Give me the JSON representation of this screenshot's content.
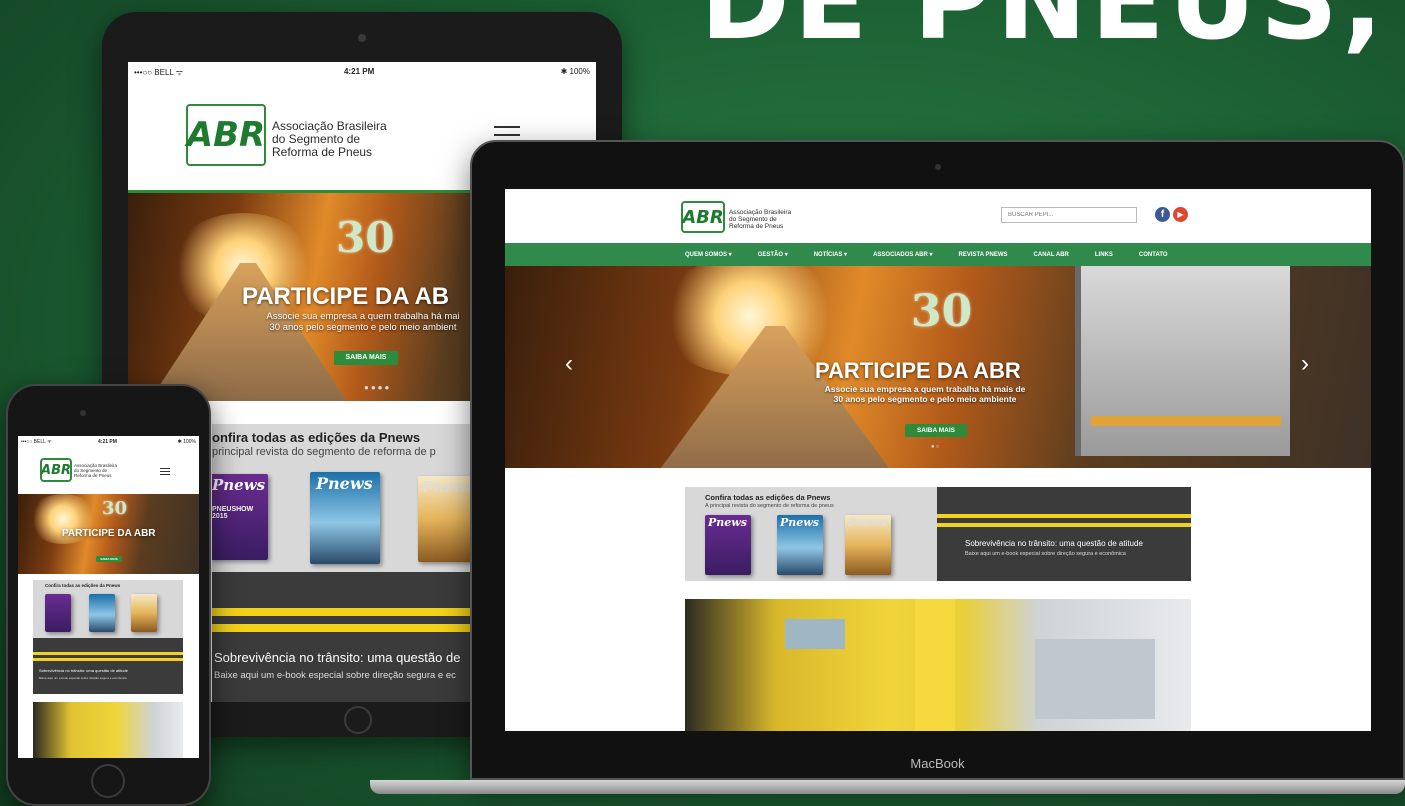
{
  "headline": "DE PNEUS,",
  "org": {
    "logo": "ABR",
    "name_lines": [
      "Associação Brasileira",
      "do Segmento de",
      "Reforma de Pneus"
    ],
    "anniversary_number": "30",
    "anniversary_word": "anos"
  },
  "tablet_status": {
    "carrier": "•••○○ BELL ᯤ",
    "time": "4:21 PM",
    "battery": "✱ 100%"
  },
  "phone_status": {
    "carrier": "•••○○ BELL ᯤ",
    "time": "4:21 PM",
    "battery": "✱ 100%"
  },
  "hero": {
    "title": "PARTICIPE DA ABR",
    "subtitle_line1": "Associe sua empresa a quem trabalha há mais de",
    "subtitle_line2": "30 anos pelo segmento e pelo meio ambiente",
    "tablet_title": "PARTICIPE DA AB",
    "tablet_sub1": "Associe sua empresa a quem trabalha há mai",
    "tablet_sub2": "30 anos pelo segmento e pelo meio ambient",
    "button": "SAIBA MAIS",
    "prev_arrow": "‹",
    "next_arrow": "›"
  },
  "site": {
    "search_placeholder": "BUSCAR PEPI...",
    "nav": [
      "QUEM SOMOS ▾",
      "GESTÃO ▾",
      "NOTÍCIAS ▾",
      "ASSOCIADOS ABR ▾",
      "REVISTA PNEWS",
      "CANAL ABR",
      "LINKS",
      "CONTATO"
    ]
  },
  "pnews": {
    "title": "Confira todas as edições da Pnews",
    "subtitle": "A principal revista do segmento de reforma de pneus",
    "tablet_title": "onfira todas as edições da Pnews",
    "tablet_subtitle": "principal revista do segmento de reforma de p",
    "cover_label": "Pnews",
    "cover1_text": "PNEUSHOW 2015"
  },
  "ebook": {
    "title": "Sobrevivência no trânsito: uma questão de atitude",
    "subtitle": "Baixe aqui um e-book especial sobre direção segura e econômica",
    "tablet_title": "Sobrevivência no trânsito: uma questão de",
    "tablet_subtitle": "Baixe aqui um e-book especial sobre direção segura e ec"
  },
  "laptop_brand": "MacBook",
  "colors": {
    "brand_green": "#2e8b3c",
    "nav_green": "#2f8a4c",
    "stripe_yellow": "#f2d21a",
    "bg_green": "#1d6335"
  },
  "icons": [
    "facebook-icon",
    "youtube-icon",
    "hamburger-menu-icon",
    "camera-icon",
    "home-button-icon"
  ]
}
